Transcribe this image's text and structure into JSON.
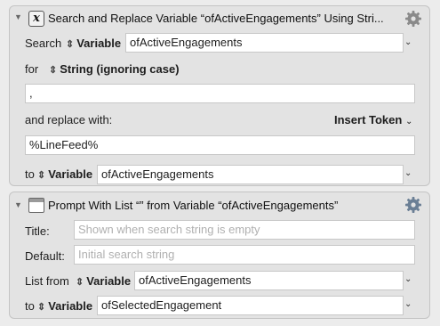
{
  "action1": {
    "title": "Search and Replace Variable “ofActiveEngagements” Using Stri...",
    "search_label": "Search",
    "search_type": "Variable",
    "search_variable": "ofActiveEngagements",
    "for_label": "for",
    "for_mode": "String (ignoring case)",
    "search_string": ",",
    "replace_label": "and replace with:",
    "insert_token": "Insert Token",
    "replace_value": "%LineFeed%",
    "to_label": "to",
    "to_type": "Variable",
    "to_variable": "ofActiveEngagements"
  },
  "action2": {
    "title": "Prompt With List “” from Variable “ofActiveEngagements”",
    "title_label": "Title:",
    "title_placeholder": "Shown when search string is empty",
    "default_label": "Default:",
    "default_placeholder": "Initial search string",
    "list_from_label": "List from",
    "list_from_type": "Variable",
    "list_from_variable": "ofActiveEngagements",
    "to_label": "to",
    "to_type": "Variable",
    "to_variable": "ofSelectedEngagement"
  },
  "icons": {
    "disclosure": "▼",
    "updown": "⌃⌄",
    "chevron": "⌄",
    "x_glyph": "x"
  }
}
